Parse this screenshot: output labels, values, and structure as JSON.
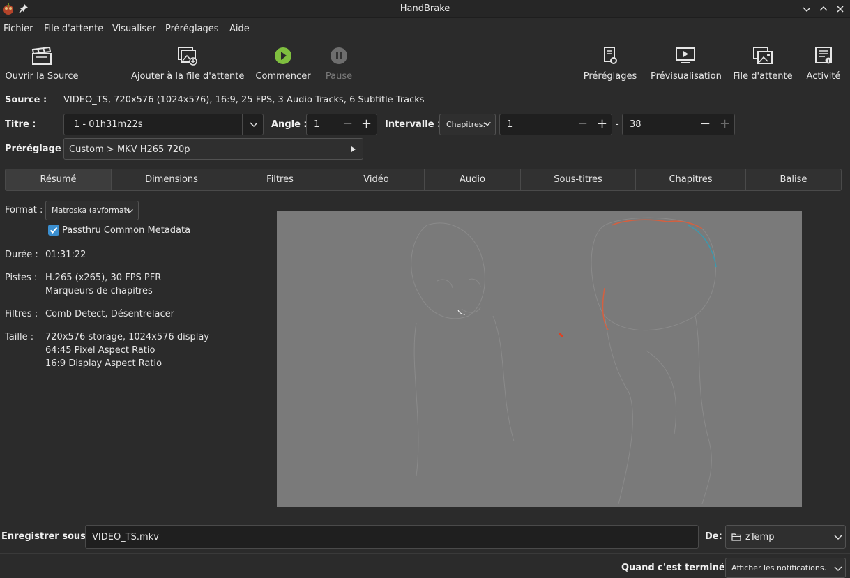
{
  "window": {
    "title": "HandBrake"
  },
  "menu": [
    "Fichier",
    "File d'attente",
    "Visualiser",
    "Préréglages",
    "Aide"
  ],
  "toolbar": {
    "open_source": "Ouvrir la Source",
    "add_queue": "Ajouter à la file d'attente",
    "start": "Commencer",
    "pause": "Pause",
    "presets": "Préréglages",
    "preview": "Prévisualisation",
    "queue": "File d'attente",
    "activity": "Activité"
  },
  "source": {
    "label": "Source :",
    "value": "VIDEO_TS, 720x576 (1024x576), 16:9, 25 FPS, 3 Audio Tracks, 6 Subtitle Tracks"
  },
  "title_row": {
    "title_label": "Titre :",
    "title_value": "1 - 01h31m22s",
    "angle_label": "Angle :",
    "angle_value": "1",
    "range_label": "Intervalle :",
    "range_type": "Chapitres:",
    "range_start": "1",
    "range_dash": "-",
    "range_end": "38",
    "minus": "−",
    "plus": "+"
  },
  "preset": {
    "label": "Préréglage :",
    "value": "Custom > MKV H265 720p"
  },
  "tabs": [
    "Résumé",
    "Dimensions",
    "Filtres",
    "Vidéo",
    "Audio",
    "Sous-titres",
    "Chapitres",
    "Balise"
  ],
  "summary": {
    "format_label": "Format :",
    "format_value": "Matroska (avformat)",
    "passthru_label": "Passthru Common Metadata",
    "passthru_checked": true,
    "duration_label": "Durée :",
    "duration_value": "01:31:22",
    "tracks_label": "Pistes :",
    "tracks_line1": "H.265 (x265), 30 FPS PFR",
    "tracks_line2": "Marqueurs de chapitres",
    "filters_label": "Filtres :",
    "filters_value": "Comb Detect, Désentrelacer",
    "size_label": "Taille :",
    "size_line1": "720x576 storage, 1024x576 display",
    "size_line2": "64:45 Pixel Aspect Ratio",
    "size_line3": "16:9 Display Aspect Ratio"
  },
  "save": {
    "label": "Enregistrer sous:",
    "value": "VIDEO_TS.mkv",
    "dest_label": "De:",
    "dest_value": "zTemp"
  },
  "finish": {
    "label": "Quand c'est terminé:",
    "value": "Afficher les notifications."
  },
  "colors": {
    "accent": "#3b8fd0",
    "play_green": "#7fbf3f",
    "background": "#2b2b2b"
  }
}
